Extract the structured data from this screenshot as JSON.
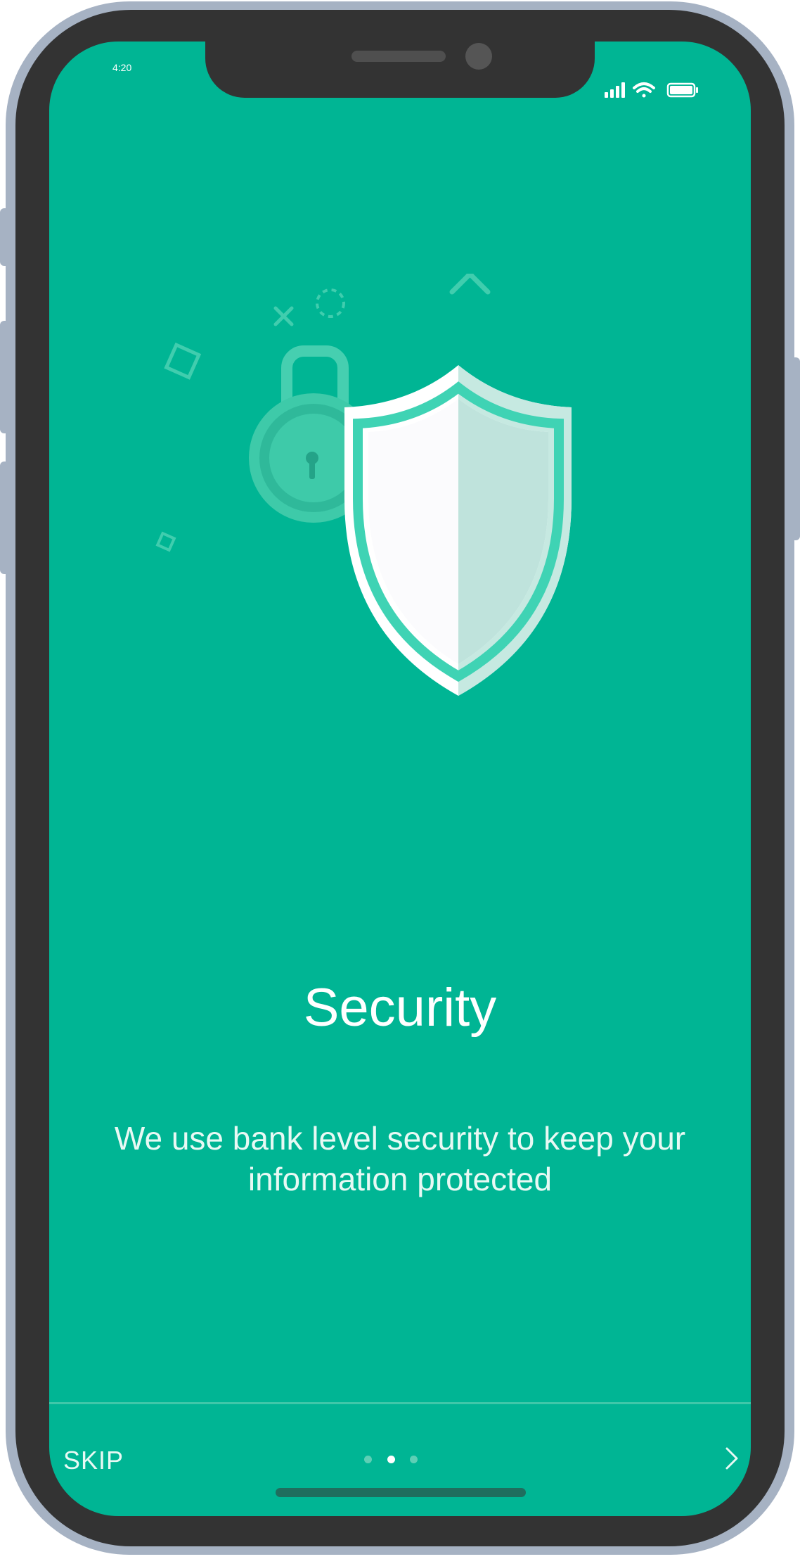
{
  "status_bar": {
    "time": "4:20",
    "signal_icon": "cellular-signal-icon",
    "wifi_icon": "wifi-icon",
    "battery_icon": "battery-icon"
  },
  "onboarding": {
    "illustration_icons": [
      "padlock-icon",
      "shield-icon"
    ],
    "title": "Security",
    "description": "We use bank level security to keep your information protected"
  },
  "footer": {
    "skip_label": "SKIP",
    "page_count": 3,
    "active_page": 2,
    "next_icon": "chevron-right-icon"
  },
  "colors": {
    "background": "#00b594",
    "accent": "#3fd3b4",
    "frame": "#a6b2c3",
    "bezel": "#333333"
  }
}
